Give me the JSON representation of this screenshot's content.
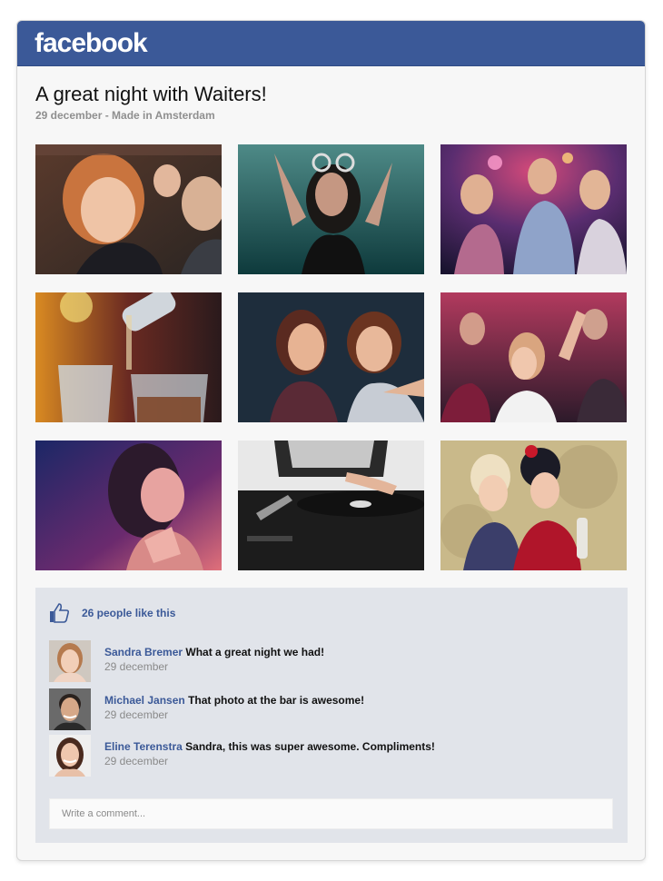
{
  "header": {
    "brand": "facebook",
    "brand_color": "#3b5998"
  },
  "post": {
    "title": "A great night with Waiters!",
    "meta": "29 december - Made in Amsterdam"
  },
  "photos": [
    {
      "subject": "girl laughing in crowd"
    },
    {
      "subject": "woman dancing by the sea"
    },
    {
      "subject": "group dancing at club"
    },
    {
      "subject": "pouring drinks at bar"
    },
    {
      "subject": "three friends smiling"
    },
    {
      "subject": "crowd cheering"
    },
    {
      "subject": "woman in pink light"
    },
    {
      "subject": "DJ at turntable"
    },
    {
      "subject": "two women whispering"
    }
  ],
  "likes": {
    "text": "26 people like this",
    "icon": "thumbs-up-icon"
  },
  "comments": [
    {
      "author": "Sandra Bremer",
      "text": "What a great night we had!",
      "date": "29 december"
    },
    {
      "author": "Michael Jansen",
      "text": "That photo at the bar is awesome!",
      "date": "29 december"
    },
    {
      "author": "Eline Terenstra",
      "text": "Sandra, this was super awesome. Compliments!",
      "date": "29 december"
    }
  ],
  "comment_input": {
    "placeholder": "Write a comment...",
    "value": ""
  },
  "colors": {
    "accent": "#3b5998",
    "panel": "#e1e4ea",
    "card": "#f7f7f7"
  }
}
